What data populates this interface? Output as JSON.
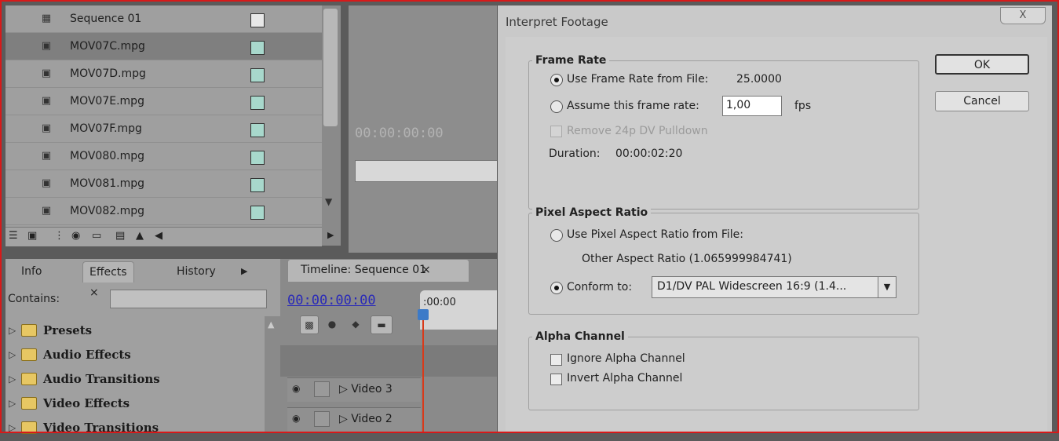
{
  "project": {
    "items": [
      {
        "name": "Sequence 01",
        "type": "sequence"
      },
      {
        "name": "MOV07C.mpg",
        "type": "clip",
        "selected": true
      },
      {
        "name": "MOV07D.mpg",
        "type": "clip"
      },
      {
        "name": "MOV07E.mpg",
        "type": "clip"
      },
      {
        "name": "MOV07F.mpg",
        "type": "clip"
      },
      {
        "name": "MOV080.mpg",
        "type": "clip"
      },
      {
        "name": "MOV081.mpg",
        "type": "clip"
      },
      {
        "name": "MOV082.mpg",
        "type": "clip"
      }
    ]
  },
  "monitor": {
    "timecode": "00:00:00:00"
  },
  "effects_panel": {
    "tabs": [
      "Info",
      "Effects",
      "History"
    ],
    "contains_label": "Contains:",
    "items": [
      "Presets",
      "Audio Effects",
      "Audio Transitions",
      "Video Effects",
      "Video Transitions"
    ]
  },
  "timeline": {
    "tab_label": "Timeline: Sequence 01",
    "timecode": "00:00:00:00",
    "ruler_start": ":00:00",
    "tracks": [
      "Video 3",
      "Video 2"
    ]
  },
  "dialog": {
    "title": "Interpret Footage",
    "close_label": "X",
    "frame_rate": {
      "title": "Frame Rate",
      "use_file_label": "Use Frame Rate from File:",
      "file_rate": "25.0000",
      "assume_label": "Assume this frame rate:",
      "assume_value": "1,00",
      "fps_label": "fps",
      "remove_pulldown_label": "Remove 24p DV Pulldown",
      "duration_label": "Duration:",
      "duration_value": "00:00:02:20"
    },
    "pixel_aspect": {
      "title": "Pixel Aspect Ratio",
      "use_file_label": "Use Pixel Aspect Ratio from File:",
      "other_ratio": "Other Aspect Ratio (1.065999984741)",
      "conform_label": "Conform to:",
      "conform_value": "D1/DV PAL Widescreen 16:9 (1.4..."
    },
    "alpha": {
      "title": "Alpha Channel",
      "ignore_label": "Ignore Alpha Channel",
      "invert_label": "Invert Alpha Channel"
    },
    "ok_label": "OK",
    "cancel_label": "Cancel"
  }
}
